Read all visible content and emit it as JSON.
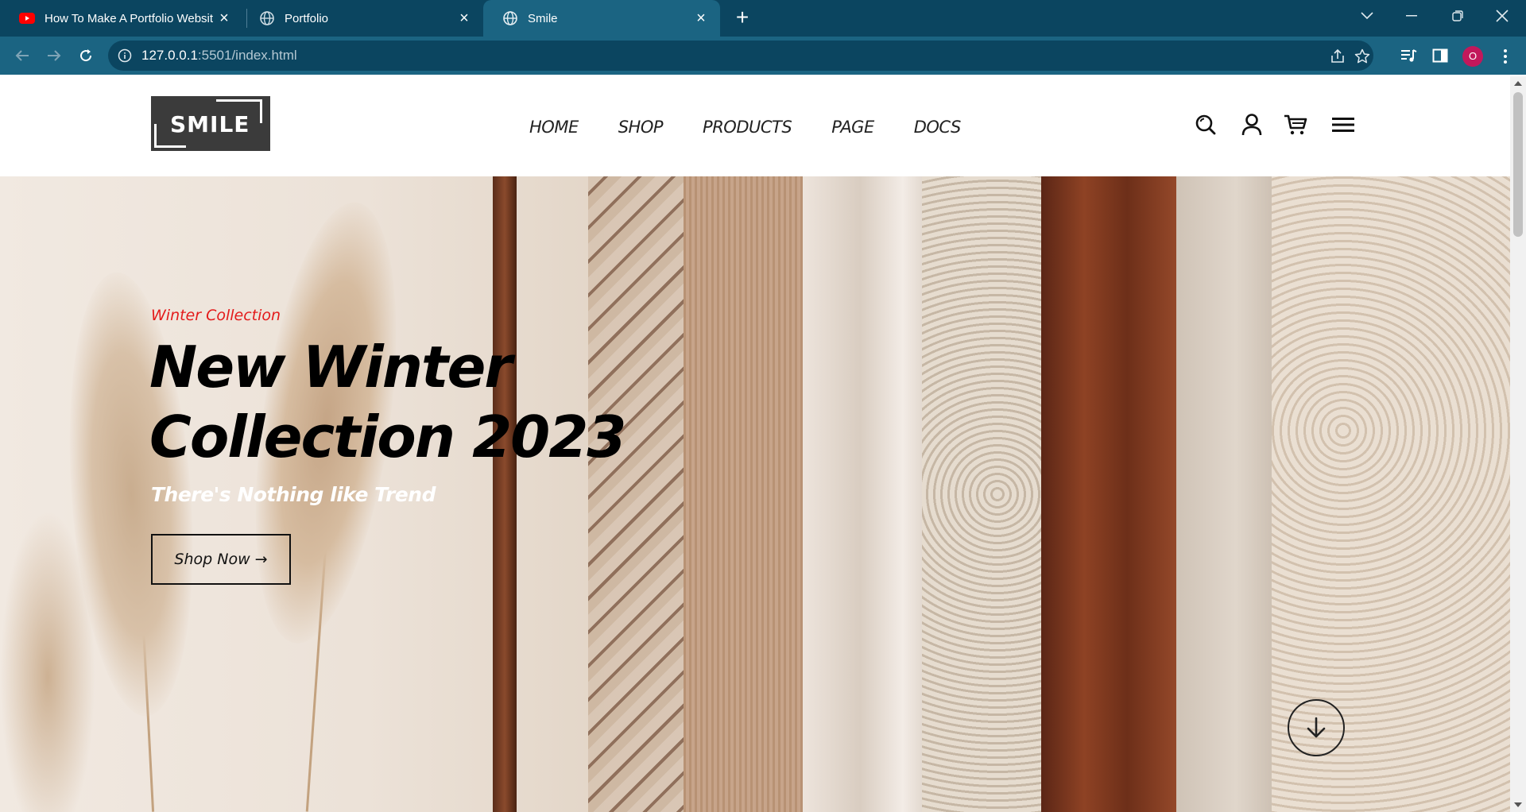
{
  "browser": {
    "tabs": [
      {
        "title": "How To Make A Portfolio Websit",
        "icon": "youtube-icon",
        "active": false
      },
      {
        "title": "Portfolio",
        "icon": "globe-icon",
        "active": false
      },
      {
        "title": "Smile",
        "icon": "globe-icon",
        "active": true
      }
    ],
    "url_host": "127.0.0.1",
    "url_rest": ":5501/index.html",
    "profile_initial": "O"
  },
  "site": {
    "nav": {
      "home": "HOME",
      "shop": "SHOP",
      "products": "PRODUCTS",
      "page": "PAGE",
      "docs": "DOCS"
    },
    "header_icons": [
      "search-icon",
      "user-icon",
      "cart-icon",
      "hamburger-icon"
    ]
  },
  "hero": {
    "kicker": "Winter Collection",
    "title_line1": "New Winter",
    "title_line2": "Collection 2023",
    "subtitle": "There's Nothing like Trend",
    "cta": "Shop Now",
    "cta_arrow": "→"
  },
  "colors": {
    "tabbar": "#0b4560",
    "active_tab": "#1b6482",
    "accent_red": "#e31b1b",
    "logo_bg": "#3b3b3b"
  }
}
